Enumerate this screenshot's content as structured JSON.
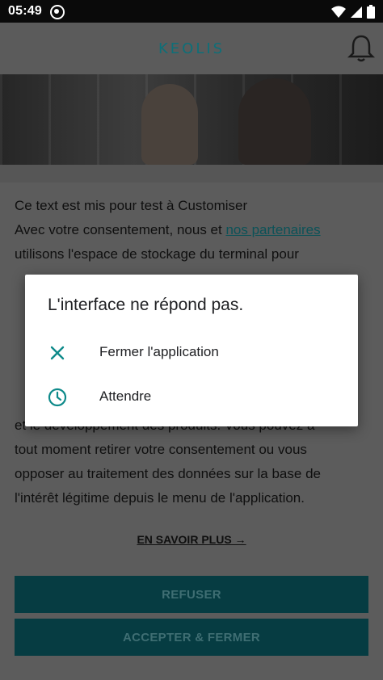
{
  "status_bar": {
    "time": "05:49",
    "icons": [
      "sync-icon",
      "wifi-icon",
      "signal-icon",
      "battery-icon"
    ]
  },
  "header": {
    "logo": "KEOLIS",
    "bell_icon": "bell-icon"
  },
  "consent": {
    "paragraph_1": "Ce text est mis pour test à Customiser",
    "paragraph_2_intro": "Avec votre consentement, nous et ",
    "partners_link": "nos partenaires",
    "paragraph_2_line_a": "utilisons l'espace de stockage du terminal pour",
    "paragraph_2_line_b": "et le développement des produits. Vous pouvez à",
    "paragraph_2_line_c": "tout moment retirer votre consentement ou vous",
    "paragraph_2_line_d": "opposer au traitement des données sur la base de",
    "paragraph_2_line_e": "l'intérêt légitime depuis le menu de l'application.",
    "learn_more": "EN SAVOIR PLUS →",
    "refuse_label": "REFUSER",
    "accept_label": "ACCEPTER & FERMER"
  },
  "dialog": {
    "title": "L'interface ne répond pas.",
    "options": [
      {
        "label": "Fermer l'application",
        "icon": "close-icon"
      },
      {
        "label": "Attendre",
        "icon": "clock-icon"
      }
    ]
  },
  "colors": {
    "accent": "#0e8a8a",
    "button_bg": "#063c42",
    "dim_overlay": "#5c5c5c"
  }
}
